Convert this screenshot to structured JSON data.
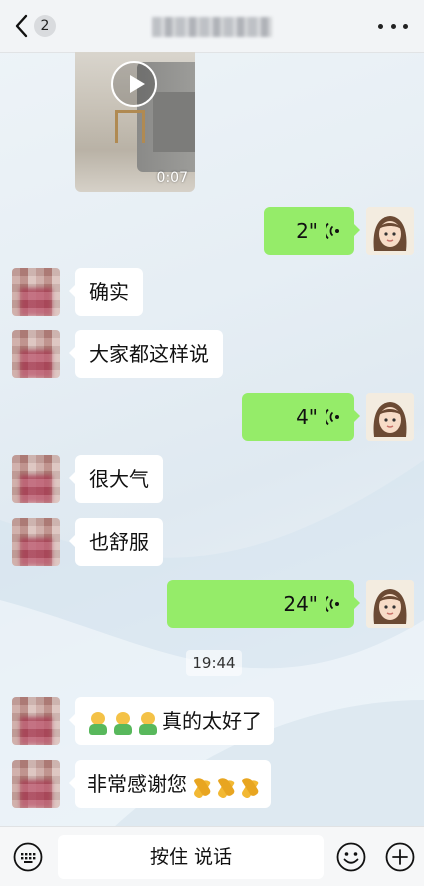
{
  "header": {
    "back_count": "2"
  },
  "video": {
    "duration": "0:07"
  },
  "messages": [
    {
      "side": "out",
      "type": "voice",
      "duration": "2\""
    },
    {
      "side": "in",
      "type": "text",
      "text": "确实"
    },
    {
      "side": "in",
      "type": "text",
      "text": "大家都这样说"
    },
    {
      "side": "out",
      "type": "voice",
      "duration": "4\""
    },
    {
      "side": "in",
      "type": "text",
      "text": "很大气"
    },
    {
      "side": "in",
      "type": "text",
      "text": "也舒服"
    },
    {
      "side": "out",
      "type": "voice",
      "duration": "24\""
    },
    {
      "side": "in",
      "type": "text",
      "text": "真的太好了",
      "emoji_prefix": [
        "man-emoji",
        "man-emoji",
        "man-emoji"
      ]
    },
    {
      "side": "in",
      "type": "text",
      "text": "非常感谢您",
      "emoji_suffix": [
        "pray-emoji",
        "pray-emoji",
        "pray-emoji"
      ]
    }
  ],
  "timestamp": "19:44",
  "input_bar": {
    "talk_label": "按住 说话"
  },
  "colors": {
    "outgoing_bubble": "#95ec69",
    "incoming_bubble": "#ffffff"
  }
}
